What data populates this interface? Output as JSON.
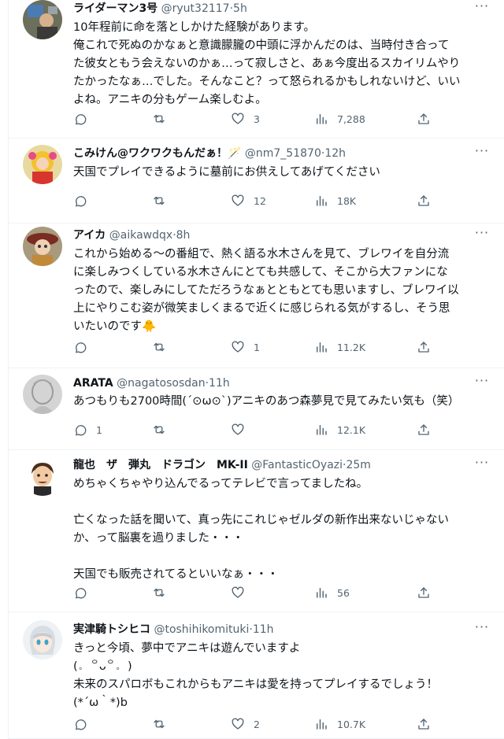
{
  "tweets": [
    {
      "name": "ライダーマン3号",
      "handle": "@ryut32117",
      "time": "5h",
      "lines": [
        "10年程前に命を落としかけた経験があります。",
        "俺これで死ぬのかなぁと意識朦朧の中頭に浮かんだのは、当時付き合って",
        "た彼女ともう会えないのかぁ…って寂しさと、あぁ今度出るスカイリムやり",
        "たかったなぁ…でした。そんなこと？って怒られるかもしれないけど、いい",
        "よね。アニキの分もゲーム楽しむよ。"
      ],
      "reply_count": "",
      "retweet_count": "",
      "like_count": "3",
      "view_count": "7,288"
    },
    {
      "name": "こみけん@ワクワクもんだぁ！🪄",
      "handle": "@nm7_51870",
      "time": "12h",
      "lines": [
        "天国でプレイできるように墓前にお供えしてあげてください"
      ],
      "reply_count": "",
      "retweet_count": "",
      "like_count": "12",
      "view_count": "18K"
    },
    {
      "name": "アイカ",
      "handle": "@aikawdqx",
      "time": "8h",
      "lines": [
        "これから始める〜の番組で、熱く語る水木さんを見て、ブレワイを自分流",
        "に楽しみつくしている水木さんにとても共感して、そこから大ファンにな",
        "ったので、楽しみにしてただろうなぁとともとても思いますし、ブレワイ以",
        "上にやりこむ姿が微笑ましくまるで近くに感じられる気がするし、そう思",
        "いたいのです🐥"
      ],
      "reply_count": "",
      "retweet_count": "",
      "like_count": "1",
      "view_count": "11.2K"
    },
    {
      "name": "ARATA",
      "handle": "@nagatososdan",
      "time": "11h",
      "lines": [
        "あつもりも2700時間(´⊙ω⊙`)アニキのあつ森夢見で見てみたい気も（笑）"
      ],
      "reply_count": "1",
      "retweet_count": "",
      "like_count": "",
      "view_count": "12.1K"
    },
    {
      "name": "龍也　ザ　弾丸　ドラゴン　MK-II",
      "handle": "@FantasticOyazi",
      "time": "25m",
      "lines": [
        "めちゃくちゃやり込んでるってテレビで言ってましたね。",
        "",
        "亡くなった話を聞いて、真っ先にこれじゃゼルダの新作出来ないじゃない",
        "か、って脳裏を過りました・・・",
        "",
        "天国でも販売されてるといいなぁ・・・"
      ],
      "reply_count": "",
      "retweet_count": "",
      "like_count": "",
      "view_count": "56"
    },
    {
      "name": "実津騎トシヒコ",
      "handle": "@toshihikomituki",
      "time": "11h",
      "lines": [
        "きっと今頃、夢中でアニキは遊んでいますよ",
        "(。 ꒪ᴗ꒪。 )",
        "未来のスパロボもこれからもアニキは愛を持ってプレイするでしょう！",
        "(*´ω｀*)b"
      ],
      "reply_count": "",
      "retweet_count": "",
      "like_count": "2",
      "view_count": "10.7K"
    }
  ],
  "icons": {
    "reply": "reply-icon",
    "retweet": "retweet-icon",
    "like": "heart-icon",
    "views": "views-icon",
    "share": "share-icon",
    "more": "more-icon"
  },
  "colors": {
    "text": "#0f1419",
    "secondary": "#536471",
    "border": "#eff3f4"
  },
  "more_label": "···",
  "separator": "·"
}
